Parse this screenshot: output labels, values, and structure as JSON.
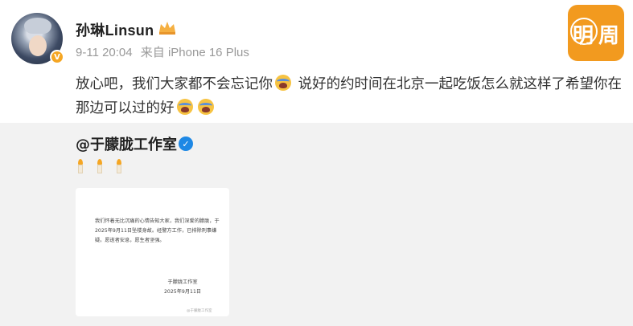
{
  "post": {
    "username": "孙琳Linsun",
    "time": "9-11 20:04",
    "source": "来自 iPhone 16 Plus",
    "text_part1": "放心吧，我们大家都不会忘记你",
    "text_part2": " 说好的约时间在北京一起吃饭怎么就这样了希望你在那边可以过的好",
    "emojis": [
      "crying-face-icon",
      "crying-face-icon",
      "crying-face-icon"
    ]
  },
  "brand": {
    "char1": "明",
    "char2": "周"
  },
  "repost": {
    "mention": "@于朦胧工作室",
    "candles": [
      "candle-icon",
      "candle-icon",
      "candle-icon"
    ],
    "card_text": "我们怀着无比沉痛的心情告知大家，我们深爱的朦胧，于2025年9月11日坠楼身故。经警方工作，已排除刑事嫌疑。愿逝者安息，愿生者坚强。",
    "card_sign": "于朦胧工作室",
    "card_date": "2025年9月11日",
    "card_watermark": "@于朦胧工作室"
  },
  "colors": {
    "brand_orange": "#f29a1f",
    "verified_blue": "#1e88e5",
    "vip_gold": "#f5a623"
  }
}
